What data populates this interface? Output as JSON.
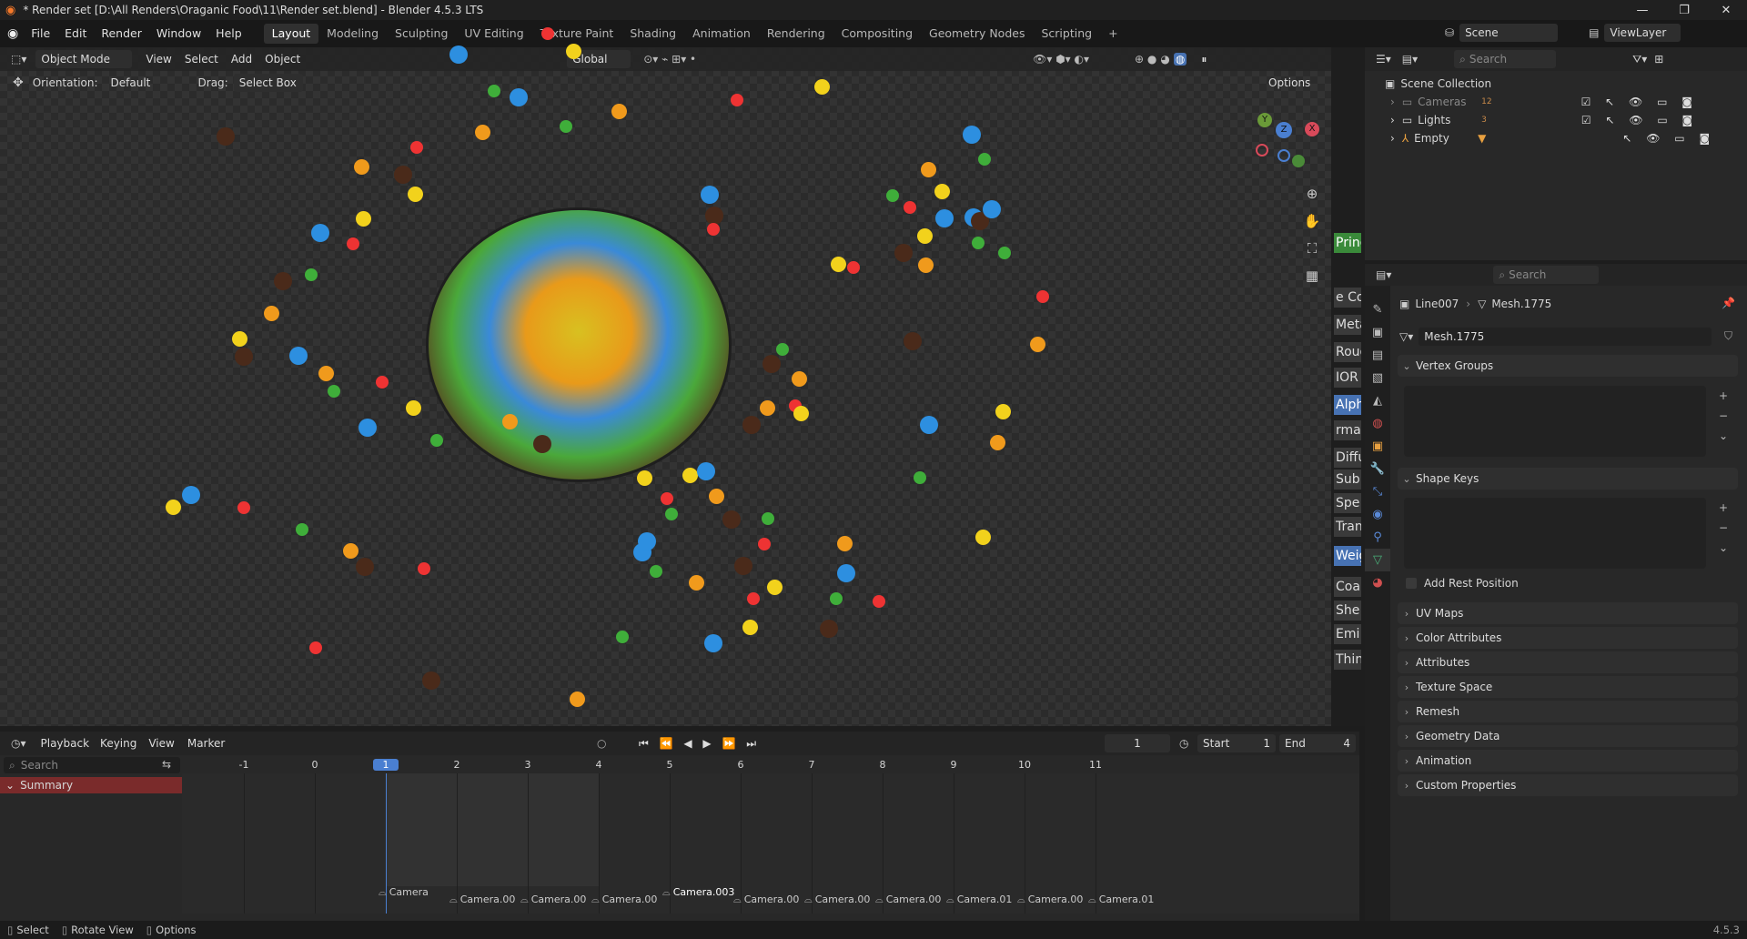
{
  "window": {
    "title": "* Render set [D:\\All Renders\\Oraganic Food\\11\\Render set.blend] - Blender 4.5.3 LTS",
    "minimize": "—",
    "maximize": "❐",
    "close": "✕"
  },
  "menu": [
    "File",
    "Edit",
    "Render",
    "Window",
    "Help"
  ],
  "workspaces": [
    "Layout",
    "Modeling",
    "Sculpting",
    "UV Editing",
    "Texture Paint",
    "Shading",
    "Animation",
    "Rendering",
    "Compositing",
    "Geometry Nodes",
    "Scripting"
  ],
  "workspace_add": "+",
  "scene": {
    "label": "Scene",
    "viewlayer": "ViewLayer"
  },
  "viewport_header": {
    "mode": "Object Mode",
    "menus": [
      "View",
      "Select",
      "Add",
      "Object"
    ],
    "transform": "Global",
    "options": "Options"
  },
  "tool_settings": {
    "orientation_label": "Orientation:",
    "orientation_value": "Default",
    "drag_label": "Drag:",
    "drag_value": "Select Box"
  },
  "gizmo": {
    "x": "X",
    "y": "Y",
    "z": "Z"
  },
  "node_tabs": [
    "Princ",
    "e Co",
    "Meta",
    "Roug",
    "IOR",
    "Alph",
    "rmal",
    "Diffu",
    "Sub",
    "Spe",
    "Tran",
    "Weig",
    "Coa",
    "She",
    "Emi",
    "Thin"
  ],
  "outliner": {
    "search_placeholder": "Search",
    "root": "Scene Collection",
    "items": [
      {
        "name": "Cameras",
        "badge": "12"
      },
      {
        "name": "Lights",
        "badge": "3"
      },
      {
        "name": "Empty",
        "badge": ""
      }
    ]
  },
  "properties": {
    "search_placeholder": "Search",
    "breadcrumb_object": "Line007",
    "breadcrumb_mesh": "Mesh.1775",
    "mesh_name": "Mesh.1775",
    "panels_open": [
      "Vertex Groups",
      "Shape Keys"
    ],
    "add_rest_position": "Add Rest Position",
    "panels_closed": [
      "UV Maps",
      "Color Attributes",
      "Attributes",
      "Texture Space",
      "Remesh",
      "Geometry Data",
      "Animation",
      "Custom Properties"
    ]
  },
  "timeline": {
    "menus": [
      "Playback",
      "Keying",
      "View",
      "Marker"
    ],
    "current_frame": "1",
    "start_label": "Start",
    "start": "1",
    "end_label": "End",
    "end": "4",
    "search_placeholder": "Search",
    "summary": "Summary",
    "frame_ticks": [
      "-1",
      "0",
      "1",
      "2",
      "3",
      "4",
      "5",
      "6",
      "7",
      "8",
      "9",
      "10",
      "11"
    ],
    "markers": [
      "Camera",
      "Camera.00",
      "Camera.00",
      "Camera.00",
      "Camera.003",
      "Camera.00",
      "Camera.00",
      "Camera.00",
      "Camera.01",
      "Camera.00",
      "Camera.01"
    ]
  },
  "status": {
    "select": "Select",
    "rotate": "Rotate View",
    "options": "Options",
    "version": "4.5.3"
  },
  "colors": {
    "accent": "#4772b3",
    "summary_red": "#7a2b2b",
    "playhead": "#4a7fd1"
  }
}
